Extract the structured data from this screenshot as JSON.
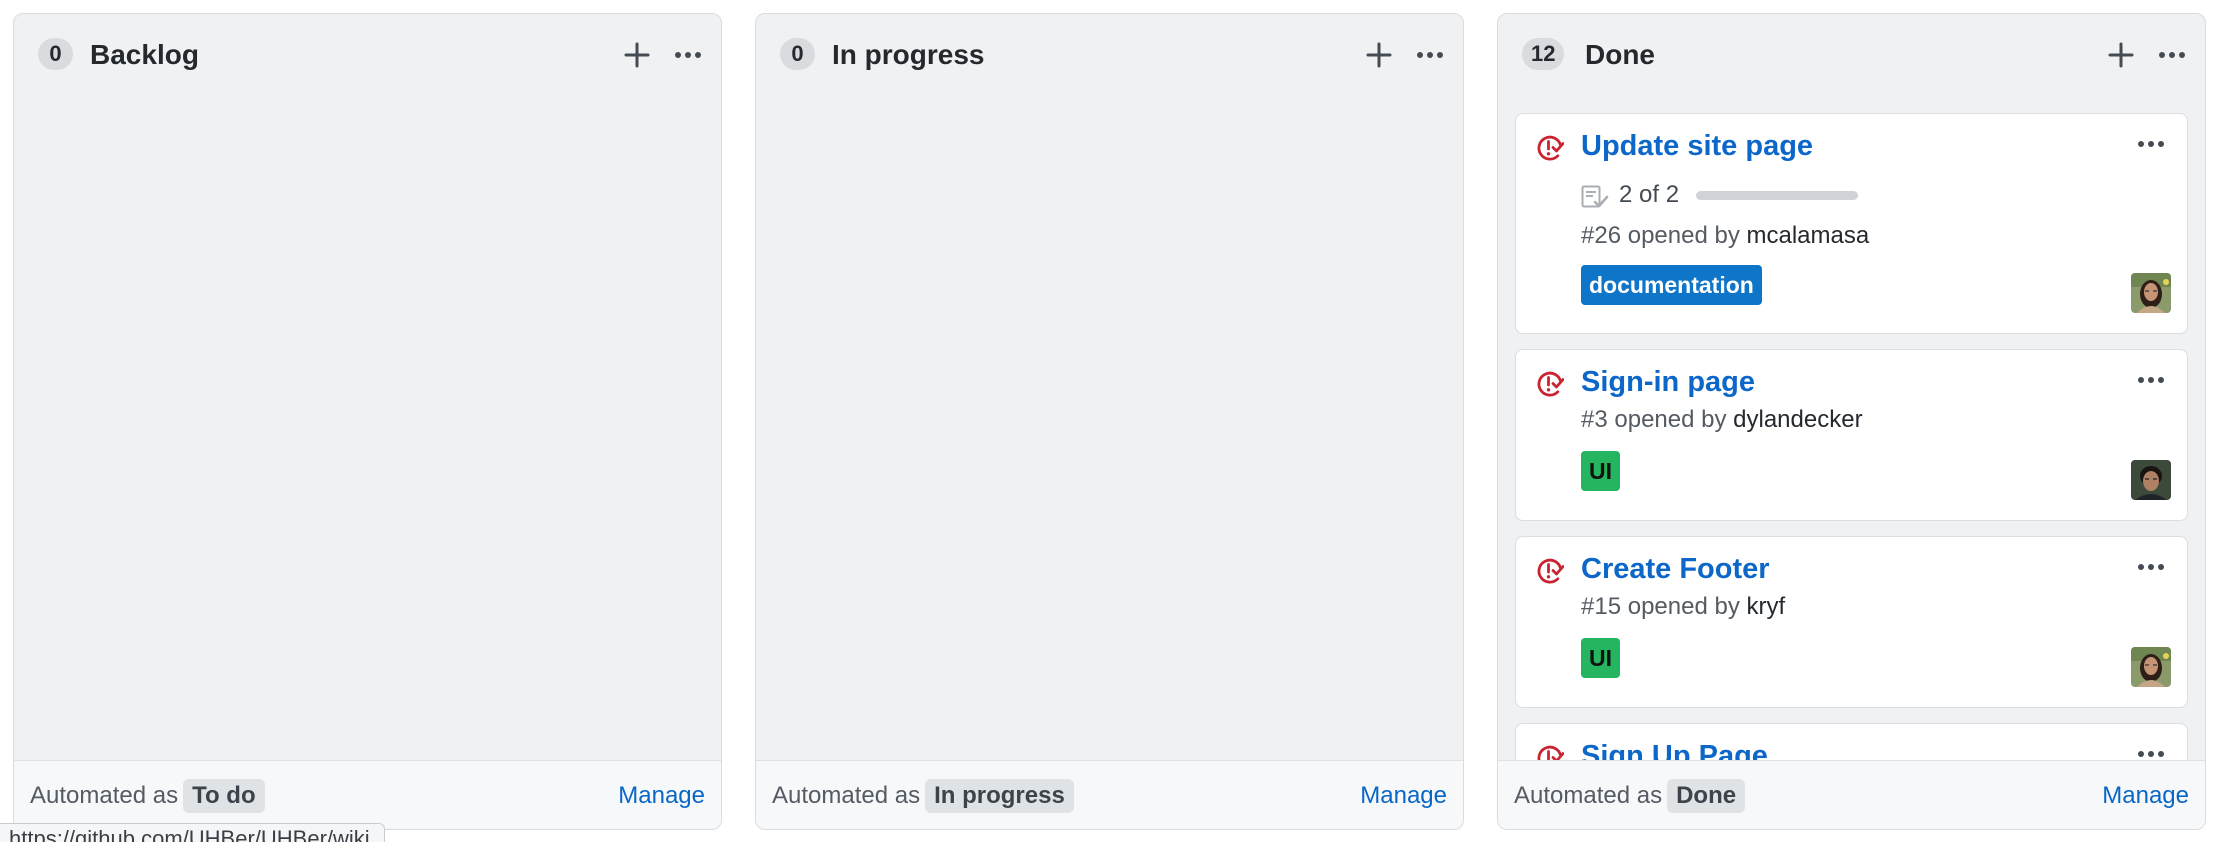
{
  "columns": [
    {
      "count": "0",
      "title": "Backlog",
      "automated_prefix": "Automated as",
      "automated_value": "To do",
      "manage_label": "Manage"
    },
    {
      "count": "0",
      "title": "In progress",
      "automated_prefix": "Automated as",
      "automated_value": "In progress",
      "manage_label": "Manage"
    },
    {
      "count": "12",
      "title": "Done",
      "automated_prefix": "Automated as",
      "automated_value": "Done",
      "manage_label": "Manage",
      "cards": [
        {
          "title": "Update site page",
          "checklist_text": "2 of 2",
          "checklist_done": 2,
          "checklist_total": 2,
          "number": "#26",
          "opened_text": "opened by",
          "author": "mcalamasa",
          "labels": [
            {
              "name": "documentation",
              "color": "#0f75c8"
            }
          ],
          "avatar": "avatar-mcalamasa"
        },
        {
          "title": "Sign-in page",
          "number": "#3",
          "opened_text": "opened by",
          "author": "dylandecker",
          "labels": [
            {
              "name": "UI",
              "color": "#25b45f"
            }
          ],
          "avatar": "avatar-dylandecker"
        },
        {
          "title": "Create Footer",
          "number": "#15",
          "opened_text": "opened by",
          "author": "kryf",
          "labels": [
            {
              "name": "UI",
              "color": "#25b45f"
            }
          ],
          "avatar": "avatar-kryf"
        },
        {
          "title": "Sign Up Page"
        }
      ]
    }
  ],
  "icons": {
    "add": "plus-icon",
    "menu": "kebab-horizontal-icon",
    "issue_closed": "issue-closed-icon",
    "checklist": "checklist-icon"
  },
  "colors": {
    "link_blue": "#0c67c9",
    "issue_closed_red": "#cb2431",
    "column_bg": "#f0f1f3"
  },
  "status_url": "https://github.com/UHBer/UHBer/wiki"
}
